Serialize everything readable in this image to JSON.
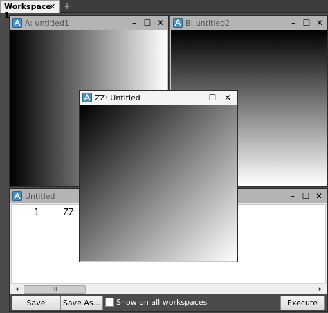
{
  "workspace_tabs": [
    {
      "label": "Workspace 1",
      "close": "✕"
    }
  ],
  "add_tab_symbol": "+",
  "window_controls": {
    "minimize": "–",
    "maximize": "☐",
    "close": "✕"
  },
  "windows": {
    "a": {
      "title": "A: untitled1"
    },
    "b": {
      "title": "B: untitled2"
    },
    "zz": {
      "title": "ZZ: Untitled"
    },
    "script": {
      "title": "Untitled"
    }
  },
  "script": {
    "line_number": "1",
    "code": "ZZ",
    "scrollbar_grip": "III",
    "scroll_left": "◂",
    "scroll_right": "▸",
    "buttons": {
      "save": "Save",
      "save_as": "Save As...",
      "execute": "Execute"
    },
    "show_on_all_workspaces": {
      "label": "Show on all workspaces",
      "checked": false
    }
  },
  "colors": {
    "app_icon": "#4a8fbf",
    "inactive_titlebar": "#b4b4b4",
    "active_titlebar": "#f4f4f4",
    "workspace_background": "#4b4b4b"
  },
  "icons": [
    "app-icon",
    "minimize-icon",
    "maximize-icon",
    "close-icon",
    "checkbox-icon"
  ]
}
